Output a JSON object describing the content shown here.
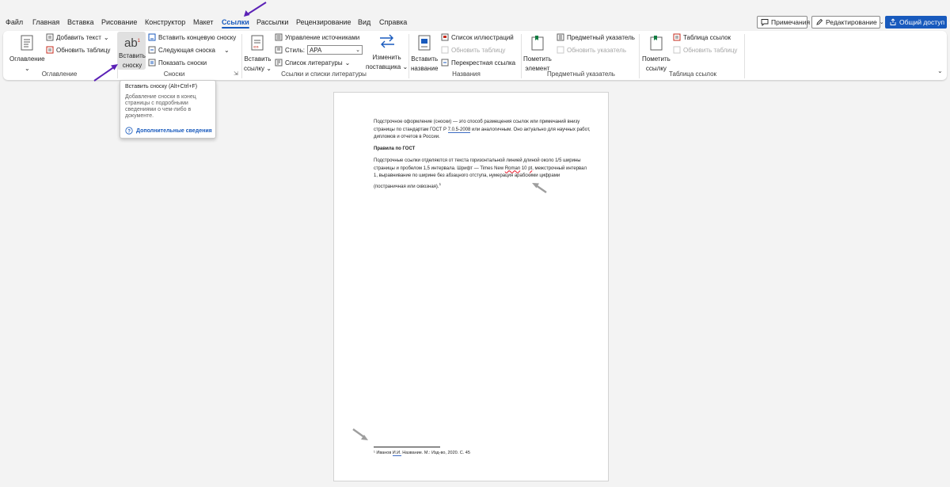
{
  "tabs": [
    "Файл",
    "Главная",
    "Вставка",
    "Рисование",
    "Конструктор",
    "Макет",
    "Ссылки",
    "Рассылки",
    "Рецензирование",
    "Вид",
    "Справка"
  ],
  "active_tab": "Ссылки",
  "top_buttons": {
    "comments": "Примечания",
    "editing": "Редактирование",
    "share": "Общий доступ"
  },
  "ribbon": {
    "toc": {
      "big_button": "Оглавление",
      "add_text": "Добавить текст",
      "update_table": "Обновить таблицу",
      "group_label": "Оглавление"
    },
    "footnotes": {
      "insert_label_1": "Вставить",
      "insert_label_2": "сноску",
      "insert_icon_text": "ab",
      "insert_endnote": "Вставить концевую сноску",
      "next_footnote": "Следующая сноска",
      "show_notes": "Показать сноски",
      "group_label": "Сноски"
    },
    "citations": {
      "insert_label_1": "Вставить",
      "insert_label_2": "ссылку",
      "manage_sources": "Управление источниками",
      "style_label": "Стиль:",
      "style_value": "APA",
      "bibliography": "Список литературы",
      "change_label_1": "Изменить",
      "change_label_2": "поставщика",
      "group_label": "Ссылки и списки литературы"
    },
    "captions": {
      "insert_label_1": "Вставить",
      "insert_label_2": "название",
      "table_of_figures": "Список иллюстраций",
      "update_table": "Обновить таблицу",
      "cross_reference": "Перекрестная ссылка",
      "group_label": "Названия"
    },
    "index": {
      "mark_label_1": "Пометить",
      "mark_label_2": "элемент",
      "insert_index": "Предметный указатель",
      "update_index": "Обновить указатель",
      "group_label": "Предметный указатель"
    },
    "authorities": {
      "mark_label_1": "Пометить",
      "mark_label_2": "ссылку",
      "insert_table": "Таблица ссылок",
      "update_table": "Обновить таблицу",
      "group_label": "Таблица ссылок"
    }
  },
  "tooltip": {
    "title": "Вставить сноску (Alt+Ctrl+F)",
    "body": "Добавление сноски в конец страницы с подробными сведениями о чем-либо в документе.",
    "more": "Дополнительные сведения"
  },
  "document": {
    "para1_a": "Подстрочное оформление (сноски) — это способ размещения ссылок или примечаний внизу страницы по стандартам ГОСТ Р ",
    "para1_gost": "7.0.5-2008",
    "para1_b": " или аналогичным. Оно актуально для научных работ, дипломов и отчетов в России.",
    "heading": "Правила по ГОСТ",
    "para2_a": "Подстрочные ссылки отделяются от текста горизонтальной линией длиной около 1/5 ширины страницы и пробелом 1,5 интервала. Шрифт — Times New ",
    "para2_roman": "Roman",
    "para2_b": " 10 ",
    "para2_pt": "pt",
    "para2_c": ", межстрочный интервал 1, выравнивание по ширине без абзацного отступа, нумерация арабскими цифрами (постраничная или сквозная).",
    "footnote_mark": "1",
    "footnote_a": "¹ Иванов ",
    "footnote_ii": "И.И.",
    "footnote_b": " Название. М.: Изд-во, 2020. С. 45"
  },
  "colors": {
    "accent": "#185abd",
    "annotation_arrow": "#5b21b6",
    "gray_arrow": "#9e9e9e"
  }
}
